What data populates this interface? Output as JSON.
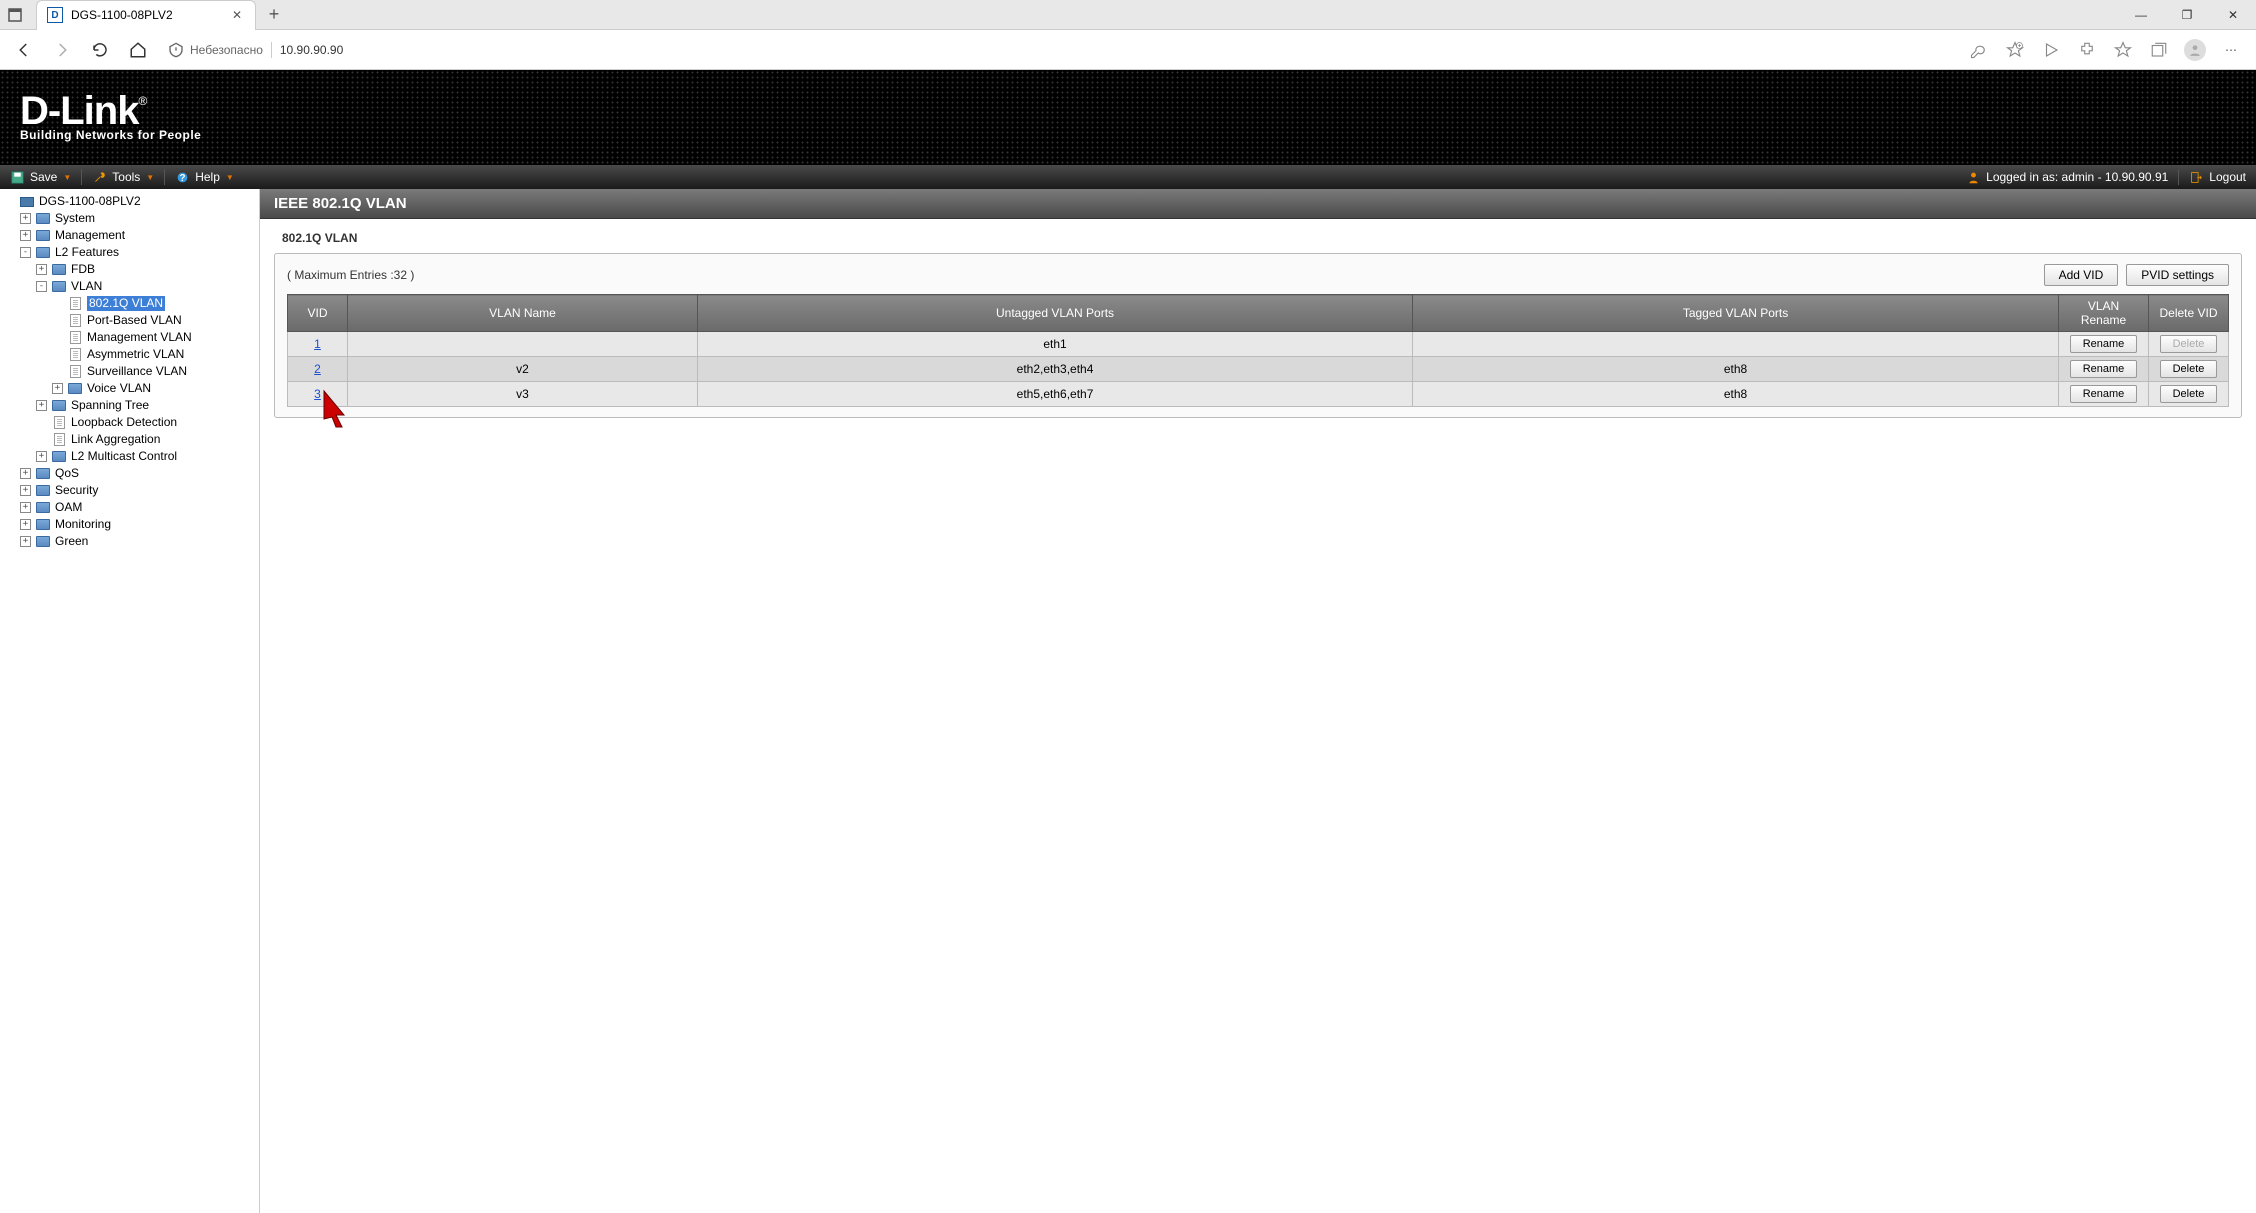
{
  "browser": {
    "tab_title": "DGS-1100-08PLV2",
    "security_label": "Небезопасно",
    "url": "10.90.90.90"
  },
  "menubar": {
    "save": "Save",
    "tools": "Tools",
    "help": "Help",
    "login_status": "Logged in as: admin - 10.90.90.91",
    "logout": "Logout"
  },
  "logo": {
    "brand": "D-Link",
    "tagline": "Building Networks for People"
  },
  "tree": {
    "root": "DGS-1100-08PLV2",
    "system": "System",
    "management": "Management",
    "l2": "L2 Features",
    "fdb": "FDB",
    "vlan": "VLAN",
    "vlan_8021q": "802.1Q VLAN",
    "vlan_portbased": "Port-Based VLAN",
    "vlan_mgmt": "Management VLAN",
    "vlan_asym": "Asymmetric VLAN",
    "vlan_surv": "Surveillance VLAN",
    "vlan_voice": "Voice VLAN",
    "stp": "Spanning Tree",
    "loopback": "Loopback Detection",
    "lag": "Link Aggregation",
    "l2mc": "L2 Multicast Control",
    "qos": "QoS",
    "security": "Security",
    "oam": "OAM",
    "monitoring": "Monitoring",
    "green": "Green"
  },
  "page": {
    "title": "IEEE 802.1Q VLAN",
    "section": "802.1Q VLAN",
    "max_entries": "( Maximum Entries :32 )",
    "add_vid": "Add VID",
    "pvid_settings": "PVID settings",
    "headers": {
      "vid": "VID",
      "name": "VLAN Name",
      "untagged": "Untagged VLAN Ports",
      "tagged": "Tagged VLAN Ports",
      "rename": "VLAN Rename",
      "delete": "Delete VID"
    },
    "rename_btn": "Rename",
    "delete_btn": "Delete",
    "rows": [
      {
        "vid": "1",
        "name": "",
        "untagged": "eth1",
        "tagged": "",
        "del_disabled": true
      },
      {
        "vid": "2",
        "name": "v2",
        "untagged": "eth2,eth3,eth4",
        "tagged": "eth8",
        "del_disabled": false
      },
      {
        "vid": "3",
        "name": "v3",
        "untagged": "eth5,eth6,eth7",
        "tagged": "eth8",
        "del_disabled": false
      }
    ]
  }
}
